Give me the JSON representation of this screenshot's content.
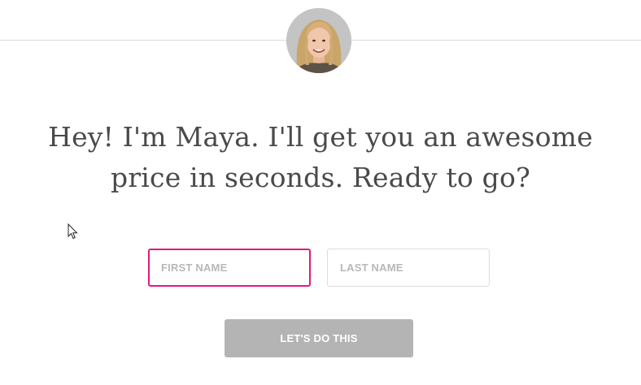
{
  "header": {
    "avatar_icon": "maya-avatar-photo"
  },
  "headline": {
    "line1": "Hey! I'm Maya. I'll get you an awesome",
    "line2": "price in seconds. Ready to go?"
  },
  "form": {
    "first_name_placeholder": "FIRST NAME",
    "last_name_placeholder": "LAST NAME",
    "first_name_value": "",
    "last_name_value": "",
    "submit_label": "LET'S DO THIS"
  },
  "colors": {
    "accent": "#e0197f",
    "button_bg": "#b4b4b4",
    "text": "#4a4a4a",
    "placeholder": "#b8b8b8"
  },
  "pointer": {
    "icon": "mouse-pointer-icon"
  }
}
